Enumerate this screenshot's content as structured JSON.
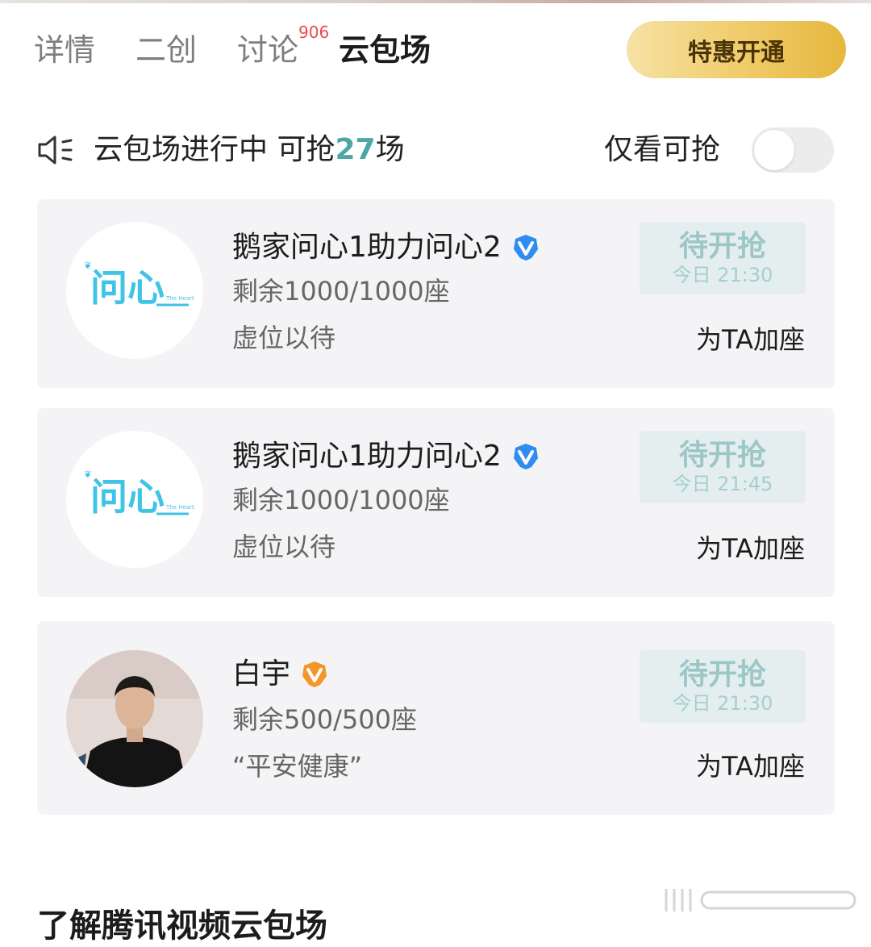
{
  "tabs": [
    {
      "label": "详情"
    },
    {
      "label": "二创"
    },
    {
      "label": "讨论",
      "badge": "906"
    },
    {
      "label": "云包场",
      "active": true
    }
  ],
  "promo_button": {
    "label": "特惠开通"
  },
  "status": {
    "prefix": "云包场进行中 可抢",
    "count": "27",
    "suffix": "场",
    "filter_label": "仅看可抢",
    "filter_on": false,
    "icon": "speaker-icon"
  },
  "cards": [
    {
      "host": "鹅家问心1助力问心2",
      "verify_icon": "blue-verified-icon",
      "avatar_text": "问心",
      "avatar_subtext": "The Heart",
      "seats": "剩余1000/1000座",
      "slogan": "虚位以待",
      "button_label": "待开抢",
      "button_time": "今日 21:30",
      "action": "为TA加座"
    },
    {
      "host": "鹅家问心1助力问心2",
      "verify_icon": "blue-verified-icon",
      "avatar_text": "问心",
      "avatar_subtext": "The Heart",
      "seats": "剩余1000/1000座",
      "slogan": "虚位以待",
      "button_label": "待开抢",
      "button_time": "今日 21:45",
      "action": "为TA加座"
    },
    {
      "host": "白宇",
      "verify_icon": "orange-verified-icon",
      "avatar_photo": "person-photo",
      "seats": "剩余500/500座",
      "slogan": "“平安健康”",
      "button_label": "待开抢",
      "button_time": "今日 21:30",
      "action": "为TA加座"
    }
  ],
  "footer": {
    "heading": "了解腾讯视频云包场"
  },
  "colors": {
    "accent_teal": "#4ea7a6",
    "badge_red": "#ea4b4b",
    "promo_gold": "#f1cf72",
    "verify_blue": "#2f8cf0",
    "verify_orange": "#f5962a"
  }
}
